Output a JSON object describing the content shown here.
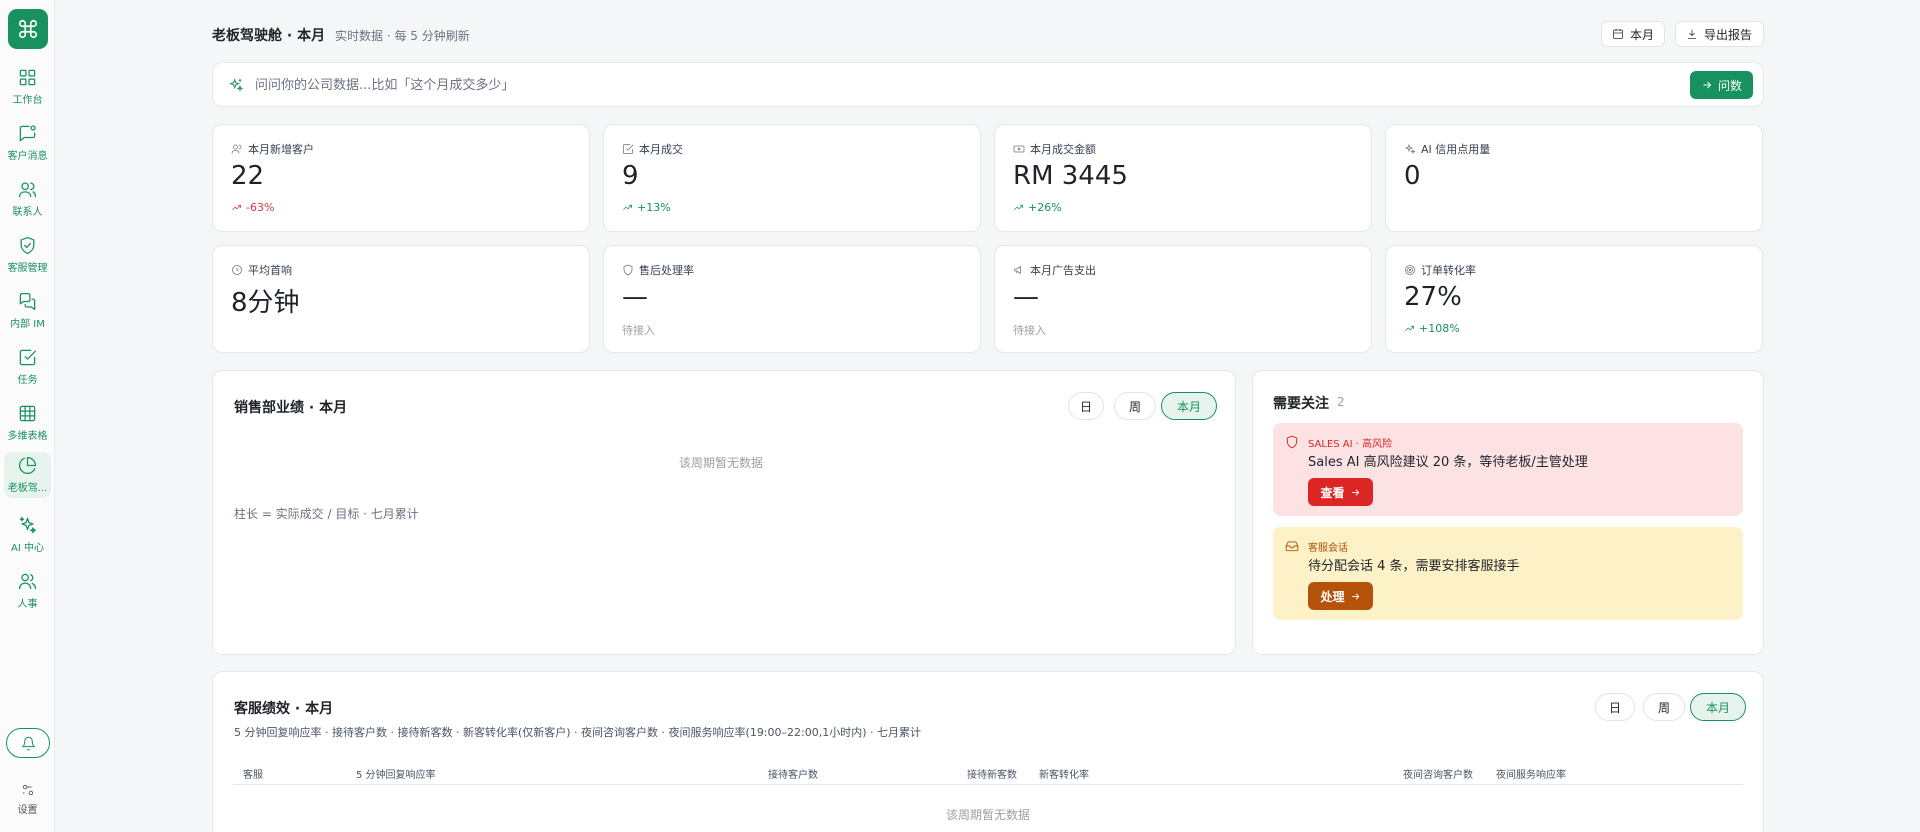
{
  "sidebar": {
    "items": [
      {
        "label": "工作台",
        "icon": "grid-icon"
      },
      {
        "label": "客户消息",
        "icon": "message-icon"
      },
      {
        "label": "联系人",
        "icon": "users-icon"
      },
      {
        "label": "客服管理",
        "icon": "shield-check-icon"
      },
      {
        "label": "内部 IM",
        "icon": "chat-icon"
      },
      {
        "label": "任务",
        "icon": "checkbox-icon"
      },
      {
        "label": "多维表格",
        "icon": "table-icon"
      },
      {
        "label": "老板驾...",
        "icon": "pie-chart-icon",
        "active": true
      },
      {
        "label": "AI 中心",
        "icon": "sparkle-icon"
      },
      {
        "label": "人事",
        "icon": "people-icon"
      }
    ],
    "settings_label": "设置"
  },
  "header": {
    "title": "老板驾驶舱 · 本月",
    "subtitle": "实时数据 · 每 5 分钟刷新",
    "period_button": "本月",
    "export_button": "导出报告"
  },
  "ask": {
    "placeholder": "问问你的公司数据...比如「这个月成交多少」",
    "button": "问数"
  },
  "kpis": [
    {
      "label": "本月新增客户",
      "value": "22",
      "delta": "-63%",
      "trend": "down"
    },
    {
      "label": "本月成交",
      "value": "9",
      "delta": "+13%",
      "trend": "up"
    },
    {
      "label": "本月成交金额",
      "value": "RM 3445",
      "delta": "+26%",
      "trend": "up"
    },
    {
      "label": "AI 信用点用量",
      "value": "0",
      "delta": "",
      "trend": "none"
    },
    {
      "label": "平均首响",
      "value": "8分钟",
      "delta": "",
      "trend": "none"
    },
    {
      "label": "售后处理率",
      "value": "—",
      "delta": "待接入",
      "trend": "muted"
    },
    {
      "label": "本月广告支出",
      "value": "—",
      "delta": "待接入",
      "trend": "muted"
    },
    {
      "label": "订单转化率",
      "value": "27%",
      "delta": "+108%",
      "trend": "up"
    }
  ],
  "sales": {
    "title": "销售部业绩 · 本月",
    "tabs": [
      "日",
      "周",
      "本月"
    ],
    "selected_tab": "本月",
    "empty": "该周期暂无数据",
    "note": "柱长 = 实际成交 / 目标 · 七月累计"
  },
  "attention": {
    "title": "需要关注",
    "count": "2",
    "alerts": [
      {
        "tag": "SALES AI · 高风险",
        "text": "Sales AI 高风险建议 20 条，等待老板/主管处理",
        "button": "查看",
        "color": "#dc2626"
      },
      {
        "tag": "客服会话",
        "text": "待分配会话 4 条，需要安排客服接手",
        "button": "处理",
        "color": "#b45309"
      }
    ]
  },
  "service": {
    "title": "客服绩效 · 本月",
    "subtitle": "5 分钟回复响应率 · 接待客户数 · 接待新客数 · 新客转化率(仅新客户) · 夜间咨询客户数 · 夜间服务响应率(19:00–22:00,1小时内) · 七月累计",
    "tabs": [
      "日",
      "周",
      "本月"
    ],
    "selected_tab": "本月",
    "columns": [
      "客服",
      "5 分钟回复响应率",
      "接待客户数",
      "接待新客数",
      "新客转化率",
      "夜间咨询客户数",
      "夜间服务响应率"
    ],
    "empty": "该周期暂无数据"
  },
  "colors": {
    "accent": "#17925e",
    "danger": "#dc2626",
    "warning": "#b45309",
    "danger_bg": "#fde2e4",
    "warning_bg": "#fdf1c7"
  }
}
